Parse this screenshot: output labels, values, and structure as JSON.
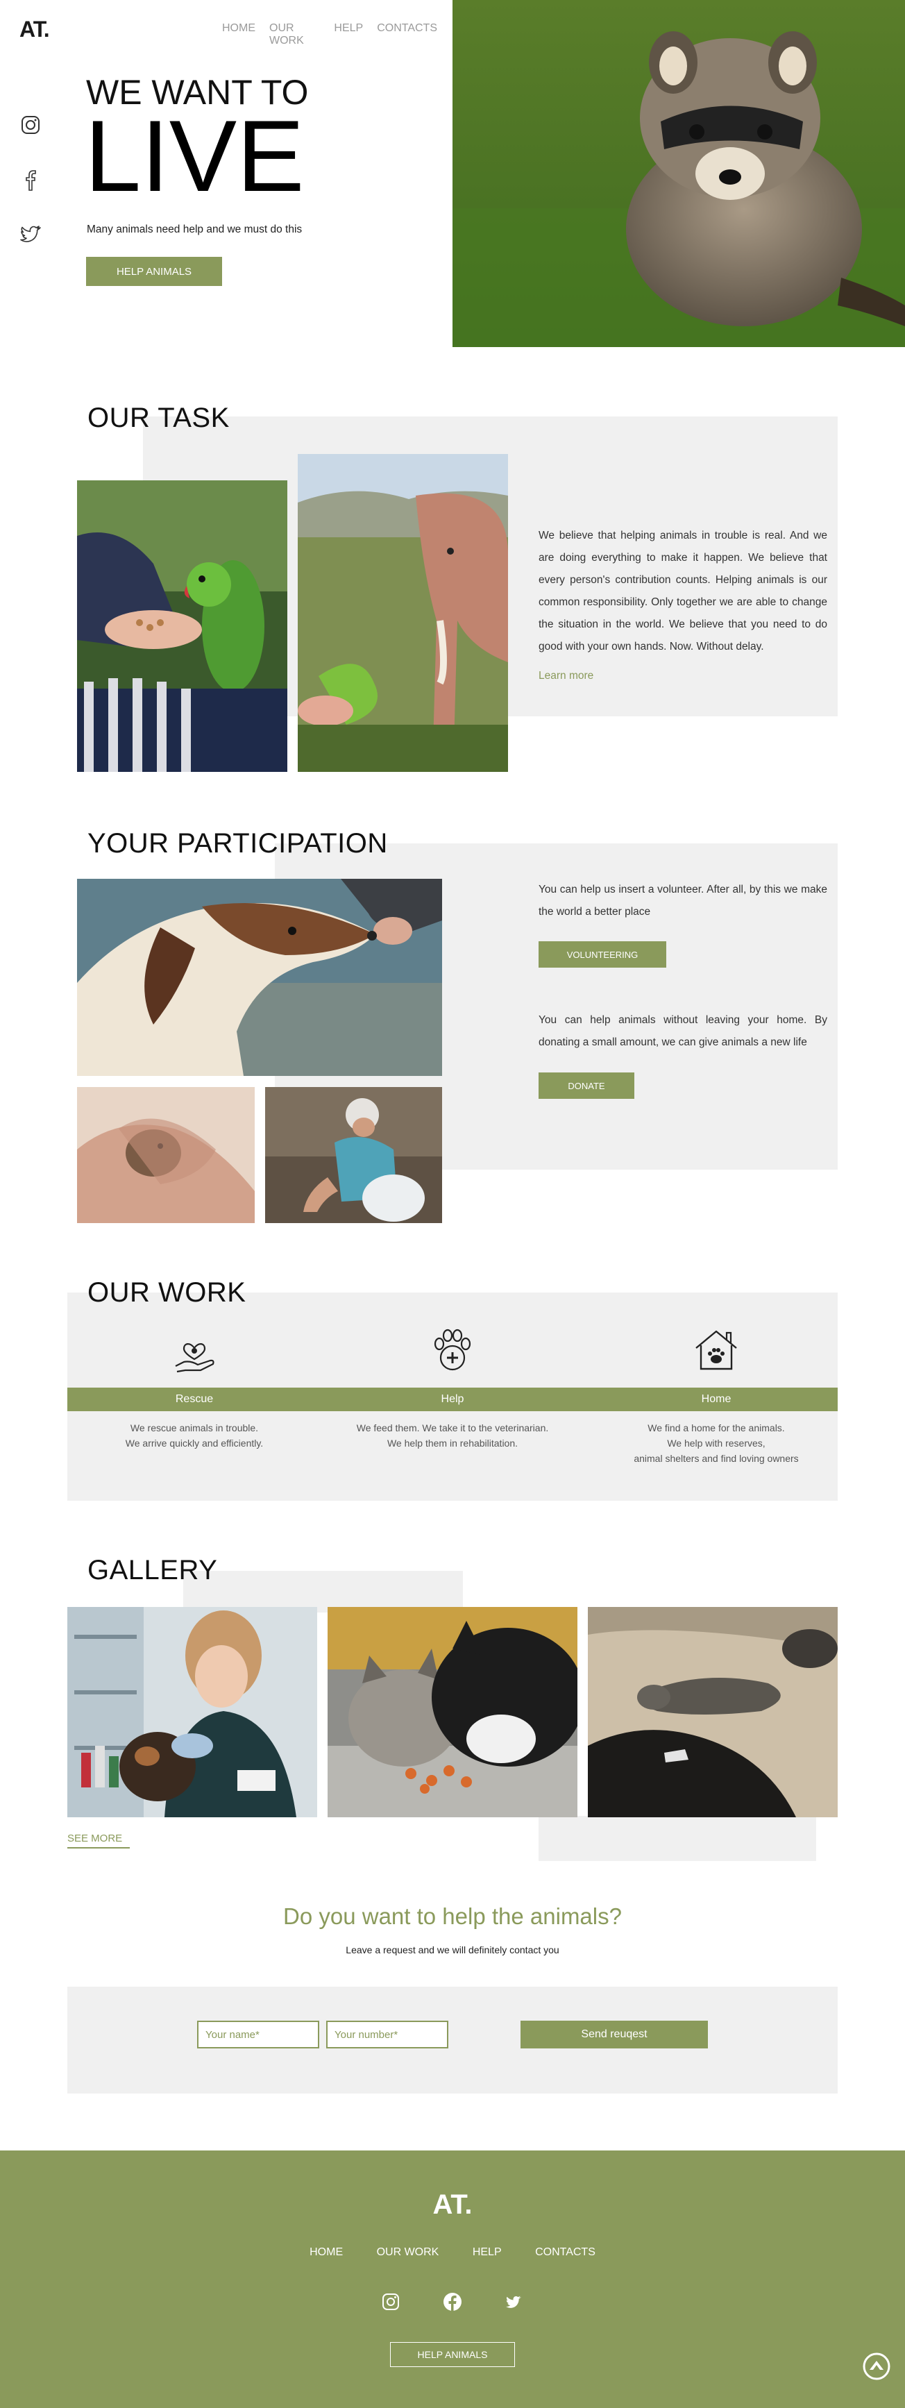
{
  "brand": {
    "logo": "AT."
  },
  "nav": {
    "items": [
      "HOME",
      "OUR WORK",
      "HELP",
      "CONTACTS"
    ]
  },
  "social": {
    "icons": [
      "instagram-icon",
      "facebook-icon",
      "twitter-icon"
    ]
  },
  "hero": {
    "line1": "WE WANT TO",
    "line2": "LIVE",
    "subtitle": "Many animals need help and we must do this",
    "button": "HELP ANIMALS"
  },
  "task": {
    "title": "OUR TASK",
    "text": "We believe that helping animals in trouble is real. And we are doing everything to make it happen. We believe that every person's contribution counts. Helping animals is our common responsibility. Only together we are able to change the situation in the world. We believe that you need to do good with your own hands. Now. Without delay.",
    "link": "Learn more"
  },
  "participation": {
    "title": "YOUR PARTICIPATION",
    "volunteer_text": "You can help us insert a volunteer. After all, by this we make the world a better place",
    "volunteer_button": "VOLUNTEERING",
    "donate_text": "You can help animals without leaving your home. By donating a small amount, we can give animals a new life",
    "donate_button": "DONATE"
  },
  "work": {
    "title": "OUR WORK",
    "items": [
      {
        "label": "Rescue",
        "line1": "We rescue animals in trouble.",
        "line2": "We arrive quickly and efficiently.",
        "line3": ""
      },
      {
        "label": "Help",
        "line1": "We feed them. We take it to the veterinarian.",
        "line2": "We help them in rehabilitation.",
        "line3": ""
      },
      {
        "label": "Home",
        "line1": "We find a home for the animals.",
        "line2": "We help with reserves,",
        "line3": "animal shelters and find loving owners"
      }
    ]
  },
  "gallery": {
    "title": "GALLERY",
    "see_more": "SEE MORE"
  },
  "contact": {
    "heading": "Do you want to help the animals?",
    "subheading": "Leave a request and we will definitely contact you",
    "name_placeholder": "Your name*",
    "number_placeholder": "Your number*",
    "send_button": "Send reuqest"
  },
  "footer": {
    "logo": "AT.",
    "nav": [
      "HOME",
      "OUR WORK",
      "HELP",
      "CONTACTS"
    ],
    "button": "HELP ANIMALS"
  },
  "colors": {
    "accent": "#8a9a5b",
    "gray_block": "#f0f0f0",
    "text": "#1a1a1a"
  }
}
